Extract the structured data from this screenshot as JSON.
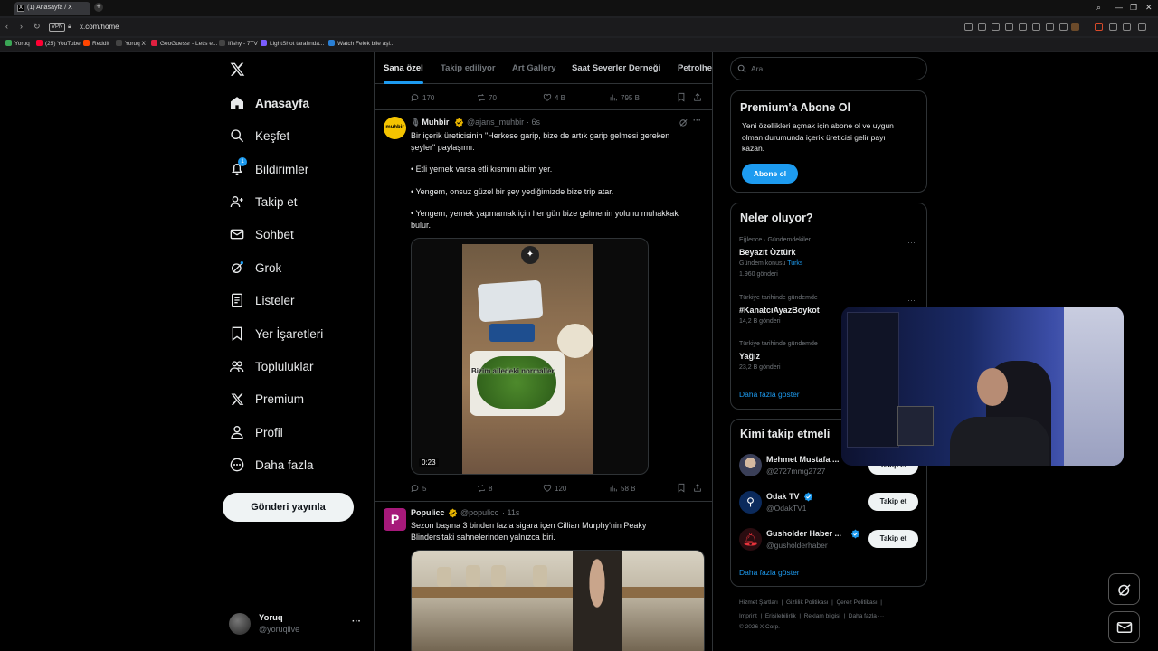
{
  "browser": {
    "tab_title": "(1) Anasayfa / X",
    "new_tab_symbol": "+",
    "vpn_label": "VPN",
    "url": "x.com/home",
    "win_min": "—",
    "win_max": "❐",
    "win_close": "✕",
    "bookmarks": [
      {
        "label": "Yoruq",
        "color": "#3aa655"
      },
      {
        "label": "(25) YouTube",
        "color": "#ff0033"
      },
      {
        "label": "Reddit",
        "color": "#ff4500"
      },
      {
        "label": "Yoruq X",
        "color": "#444444"
      },
      {
        "label": "GeoGuessr - Let's e...",
        "color": "#e02040"
      },
      {
        "label": "Ifishy - 7TV",
        "color": "#444444"
      },
      {
        "label": "LightShot tarafında...",
        "color": "#7a5cff"
      },
      {
        "label": "Watch Felek bile aşl...",
        "color": "#2a7fd4"
      }
    ]
  },
  "nav": {
    "items": [
      {
        "label": "Anasayfa",
        "icon": "home-icon"
      },
      {
        "label": "Keşfet",
        "icon": "search-icon"
      },
      {
        "label": "Bildirimler",
        "icon": "bell-icon",
        "badge": "1"
      },
      {
        "label": "Takip et",
        "icon": "follow-icon"
      },
      {
        "label": "Sohbet",
        "icon": "mail-icon"
      },
      {
        "label": "Grok",
        "icon": "grok-icon"
      },
      {
        "label": "Listeler",
        "icon": "list-icon"
      },
      {
        "label": "Yer İşaretleri",
        "icon": "bookmark-icon"
      },
      {
        "label": "Topluluklar",
        "icon": "communities-icon"
      },
      {
        "label": "Premium",
        "icon": "x-logo-icon"
      },
      {
        "label": "Profil",
        "icon": "profile-icon"
      },
      {
        "label": "Daha fazla",
        "icon": "more-icon"
      }
    ],
    "post_button": "Gönderi yayınla",
    "account": {
      "name": "Yoruq",
      "handle": "@yoruqlive",
      "more": "···"
    }
  },
  "feed": {
    "tabs": [
      "Sana özel",
      "Takip ediliyor",
      "Art Gallery",
      "Saat Severler Derneği",
      "Petrolhea"
    ],
    "prev_post_stats": {
      "replies": "170",
      "reposts": "70",
      "likes": "4 B",
      "views": "795 B"
    },
    "posts": [
      {
        "avatar_text": "muhbir",
        "name": "Muhbir",
        "handle": "@ajans_muhbir",
        "time": "· 6s",
        "lines": [
          "Bir içerik üreticisinin \"Herkese garip, bize de artık garip gelmesi gereken",
          "şeyler\" paylaşımı:",
          "• Etli yemek varsa etli kısmını abim yer.",
          "• Yengem, onsuz güzel bir şey yediğimizde bize trip atar.",
          "• Yengem, yemek yapmamak için her gün bize gelmenin yolunu muhakkak",
          "bulur."
        ],
        "video_caption": "Bizim ailedeki normaller",
        "video_time": "0:23",
        "stats": {
          "replies": "5",
          "reposts": "8",
          "likes": "120",
          "views": "58 B"
        }
      },
      {
        "avatar_text": "P",
        "name": "Populicc",
        "handle": "@populicc",
        "time": "· 11s",
        "lines": [
          "Sezon başına 3 binden fazla sigara içen Cillian Murphy'nin Peaky",
          "Blinders'taki sahnelerinden yalnızca biri."
        ]
      }
    ]
  },
  "right": {
    "search_placeholder": "Ara",
    "premium": {
      "title": "Premium'a Abone Ol",
      "text_lines": [
        "Yeni özellikleri açmak için abone ol ve uygun",
        "olman durumunda içerik üreticisi gelir payı",
        "kazan."
      ],
      "button": "Abone ol"
    },
    "trends": {
      "title": "Neler oluyor?",
      "items": [
        {
          "meta": "Eğlence · Gündemdekiler",
          "name": "Beyazıt Öztürk",
          "sub_prefix": "Gündem konusu ",
          "sub_link": "Turks",
          "count": "1.960 gönderi"
        },
        {
          "meta": "Türkiye tarihinde gündemde",
          "name": "#KanatcıAyazBoykot",
          "count": "14,2 B gönderi"
        },
        {
          "meta": "Türkiye tarihinde gündemde",
          "name": "Yağız",
          "count": "23,2 B gönderi"
        }
      ],
      "show_more": "Daha fazla göster",
      "dots": "···"
    },
    "who_to_follow": {
      "title": "Kimi takip etmeli",
      "items": [
        {
          "name": "Mehmet Mustafa ...",
          "handle": "@2727mmg2727",
          "button": "Takip et"
        },
        {
          "name": "Odak TV",
          "handle": "@OdakTV1",
          "button": "Takip et"
        },
        {
          "name": "Gusholder Haber ...",
          "handle": "@gusholderhaber",
          "button": "Takip et"
        }
      ],
      "show_more": "Daha fazla göster"
    },
    "footer": {
      "row1": [
        "Hizmet Şartları",
        "|",
        "Gizlilik Politikası",
        "|",
        "Çerez Politikası",
        "|"
      ],
      "row2": [
        "Imprint",
        "|",
        "Erişilebilirlik",
        "|",
        "Reklam bilgisi",
        "|",
        "Daha fazla ···"
      ],
      "copyright": "© 2026 X Corp."
    }
  },
  "colors": {
    "accent": "#1d9bf0",
    "background": "#000000",
    "border": "#2f3336",
    "muted": "#71767b",
    "gold_badge": "#e8b400"
  }
}
